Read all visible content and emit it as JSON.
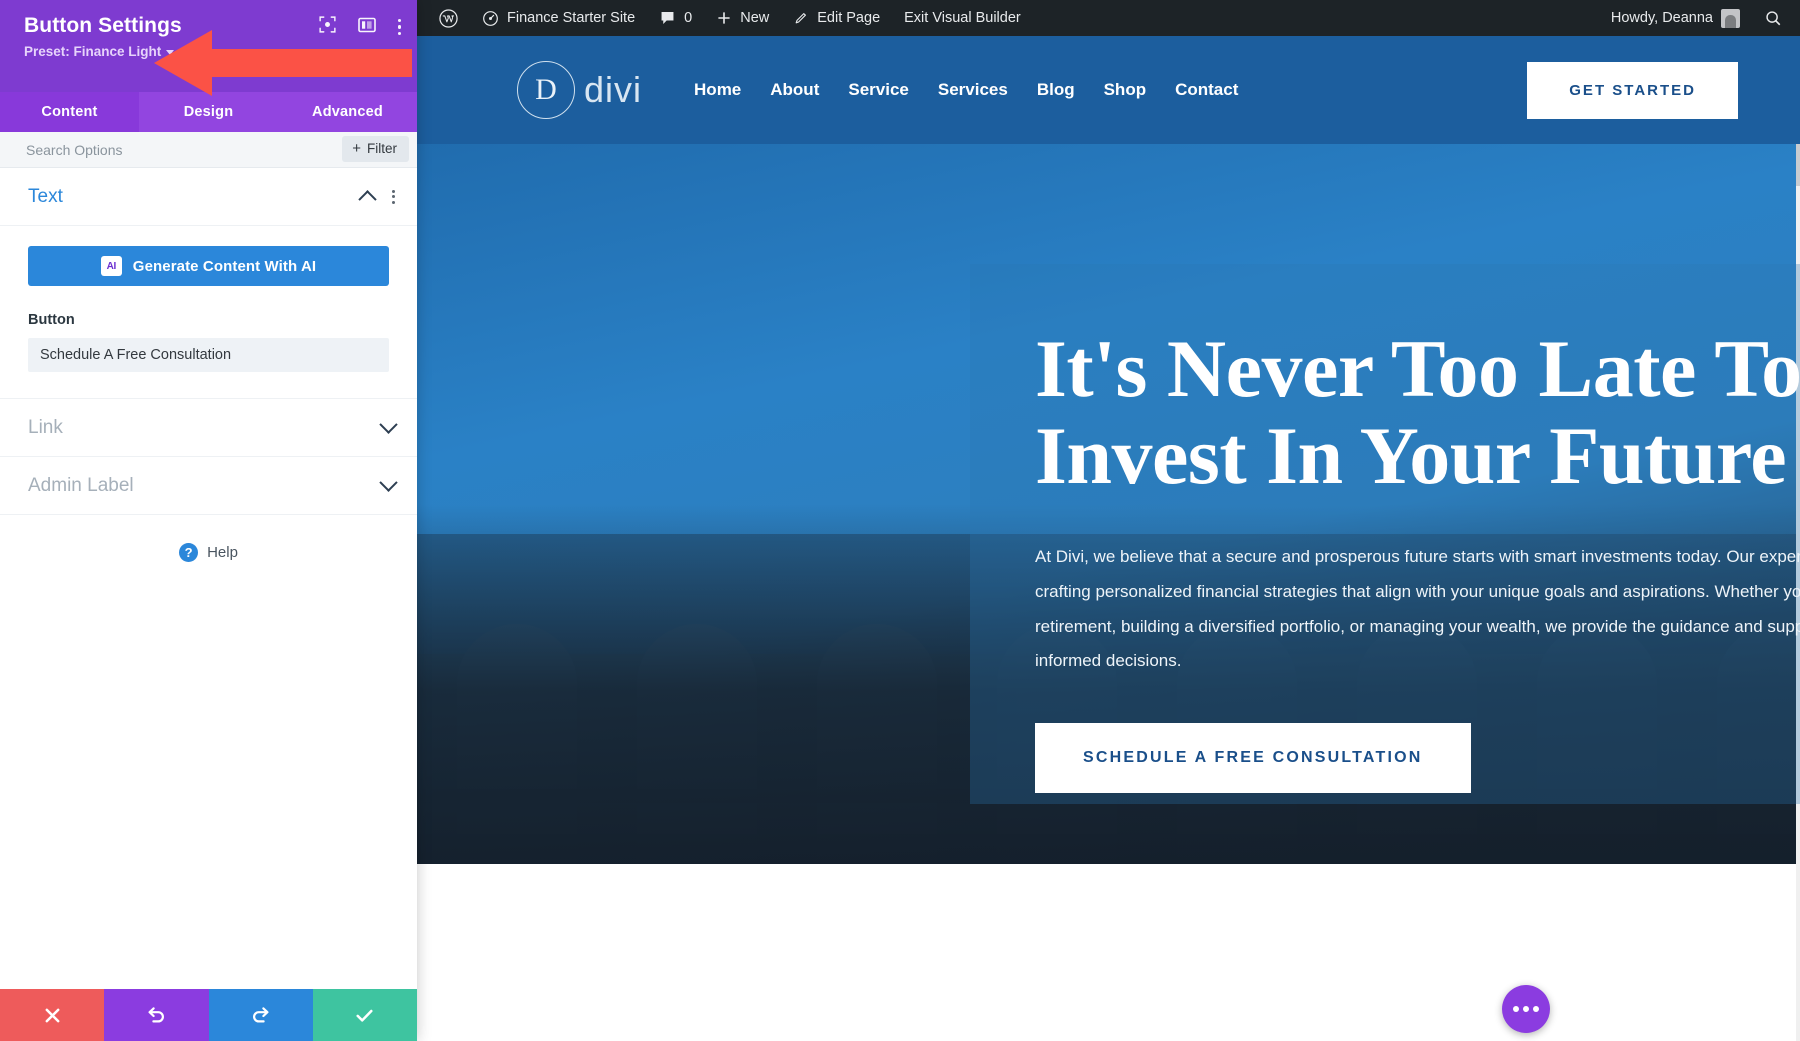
{
  "panel": {
    "title": "Button Settings",
    "preset_label": "Preset: Finance Light",
    "head_icons": [
      {
        "name": "focus-target-icon"
      },
      {
        "name": "layout-columns-icon"
      },
      {
        "name": "kebab-menu-icon"
      }
    ],
    "tabs": [
      {
        "label": "Content",
        "active": true
      },
      {
        "label": "Design",
        "active": false
      },
      {
        "label": "Advanced",
        "active": false
      }
    ],
    "search_placeholder": "Search Options",
    "search_value": "",
    "filter_label": "Filter",
    "sections": [
      {
        "name": "Text",
        "expanded": true
      },
      {
        "name": "Link",
        "expanded": false
      },
      {
        "name": "Admin Label",
        "expanded": false
      }
    ],
    "ai_button_label": "Generate Content With AI",
    "ai_chip_label": "AI",
    "button_field_label": "Button",
    "button_field_value": "Schedule A Free Consultation",
    "help_label": "Help",
    "actions": [
      {
        "name": "cancel",
        "glyph": "✕",
        "color": "#ee5b5b"
      },
      {
        "name": "undo",
        "glyph": "↺",
        "color": "#8b3ce0"
      },
      {
        "name": "redo",
        "glyph": "↻",
        "color": "#2b87da"
      },
      {
        "name": "save",
        "glyph": "✓",
        "color": "#3ec4a0"
      }
    ],
    "accent_purple": "#7e3bd0",
    "callout_arrow_color": "#fb5246"
  },
  "adminbar": {
    "wp_logo": "wordpress-icon",
    "site_name": "Finance Starter Site",
    "comment_count": "0",
    "new_label": "New",
    "edit_page_label": "Edit Page",
    "exit_builder_label": "Exit Visual Builder",
    "howdy": "Howdy, Deanna",
    "search_icon": "search-icon"
  },
  "site": {
    "logo_letter": "D",
    "logo_word": "divi",
    "nav": [
      "Home",
      "About",
      "Service",
      "Services",
      "Blog",
      "Shop",
      "Contact"
    ],
    "nav_cta": "GET STARTED",
    "hero_heading_line1": "It's Never Too Late To",
    "hero_heading_line2": "Invest In Your Future",
    "hero_paragraph": "At Divi, we believe that a secure and prosperous future starts with smart investments today. Our expert team is dedicated to crafting personalized financial strategies that align with your unique goals and aspirations. Whether you're planning for retirement, building a diversified portfolio, or managing your wealth, we provide the guidance and support you need to make informed decisions.",
    "hero_button": "SCHEDULE A FREE CONSULTATION",
    "scroll_glyph": "↓",
    "brand_blue": "#1c5e9e",
    "cta_text_color": "#1a4f8a"
  }
}
